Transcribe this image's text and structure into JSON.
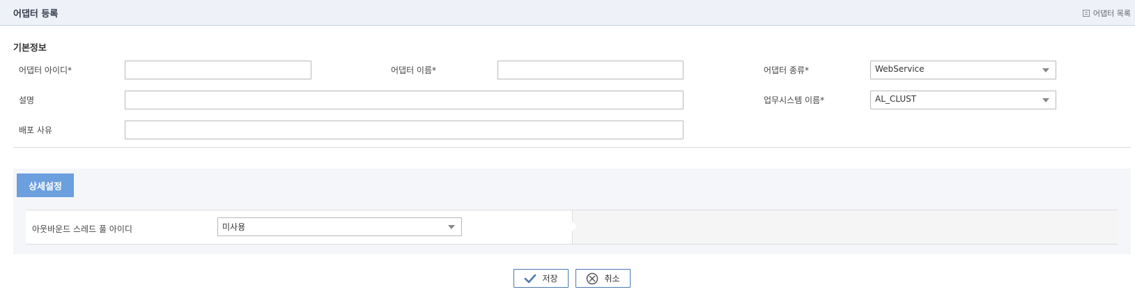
{
  "header": {
    "title": "어댑터 등록",
    "list_link": "어댑터 목록"
  },
  "basic": {
    "section_title": "기본정보",
    "adapter_id_label": "어댑터 아이디*",
    "adapter_id_value": "",
    "adapter_name_label": "어댑터 이름*",
    "adapter_name_value": "",
    "adapter_type_label": "어댑터 종류*",
    "adapter_type_value": "WebService",
    "description_label": "설명",
    "description_value": "",
    "system_name_label": "업무시스템 이름*",
    "system_name_value": "AL_CLUST",
    "deploy_reason_label": "배포 사유",
    "deploy_reason_value": ""
  },
  "detail": {
    "tab_label": "상세설정",
    "thread_pool_label": "아웃바운드 스레드 풀 아이디",
    "thread_pool_value": "미사용"
  },
  "buttons": {
    "save_label": "저장",
    "cancel_label": "취소"
  },
  "colors": {
    "accent": "#6b9fde",
    "button_border": "#4a78b0"
  }
}
